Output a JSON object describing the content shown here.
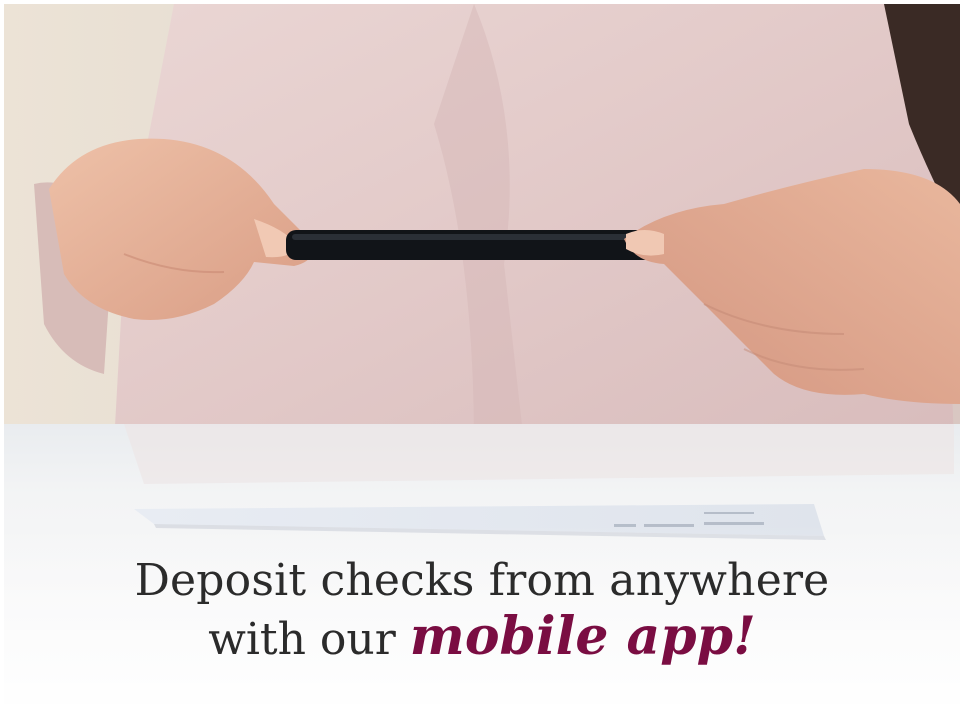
{
  "ad": {
    "headline_line1": "Deposit checks from anywhere",
    "headline_line2_prefix": "with our",
    "headline_line2_emphasis": "mobile app!"
  },
  "colors": {
    "accent": "#7a0d42",
    "text": "#2b2b2b",
    "blouse": "#e7cfd0",
    "background": "#e9e0d6",
    "desk": "#f4f4f4"
  }
}
